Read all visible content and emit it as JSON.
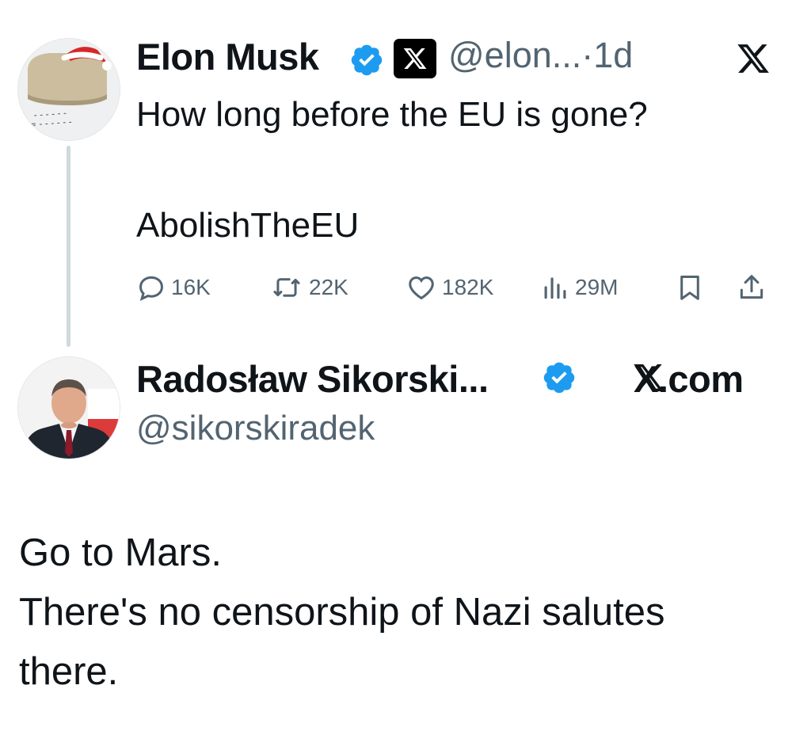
{
  "original_tweet": {
    "author_name": "Elon Musk",
    "handle": "@elon...",
    "separator": "·",
    "time": "1d",
    "text_line1": "How long before the EU is gone?",
    "text_line2": "AbolishTheEU",
    "stats": {
      "replies": "16K",
      "retweets": "22K",
      "likes": "182K",
      "views": "29M"
    }
  },
  "reply_tweet": {
    "author_name": "Radosław Sikorski...",
    "handle": "@sikorskiradek",
    "site_label": "X.com",
    "text_line1": "Go to Mars.",
    "text_line2": "There's no censorship of Nazi salutes",
    "text_line3": "there."
  },
  "colors": {
    "verified_blue": "#1d9bf0",
    "text": "#0f1419",
    "muted": "#536471",
    "thread_line": "#cfd9de"
  },
  "icons": [
    "verified-badge-icon",
    "x-logo-icon",
    "reply-icon",
    "retweet-icon",
    "like-icon",
    "views-icon",
    "bookmark-icon",
    "share-icon"
  ]
}
